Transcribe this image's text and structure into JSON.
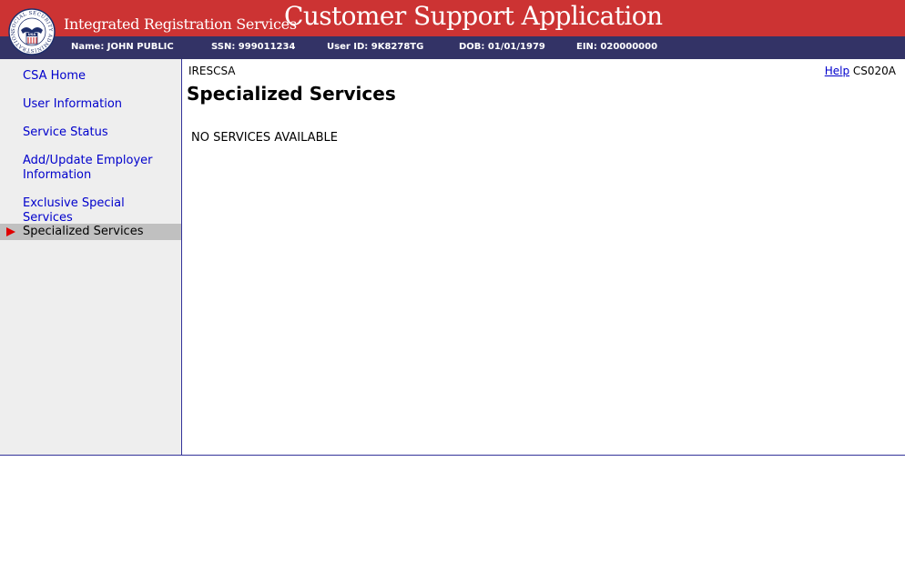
{
  "header": {
    "org_title": "Integrated Registration Services",
    "app_title": "Customer Support Application",
    "seal_text": "SOCIAL SECURITY ADMINISTRATION",
    "seal_center": "USA",
    "brand_color": "#cc3333",
    "bar_color": "#333366"
  },
  "user_bar": {
    "name": "Name: JOHN PUBLIC",
    "ssn": "SSN: 999011234",
    "user_id": "User ID: 9K8278TG",
    "dob": "DOB: 01/01/1979",
    "ein": "EIN: 020000000"
  },
  "sidebar": {
    "items": [
      {
        "label": "CSA Home"
      },
      {
        "label": "User Information"
      },
      {
        "label": "Service Status"
      },
      {
        "label": "Add/Update Employer Information"
      },
      {
        "label": "Exclusive Special Services"
      },
      {
        "label": "Specialized Services",
        "active": true
      }
    ],
    "active_marker_icon": "red-triangle-right-icon"
  },
  "main": {
    "app_code": "IRESCSA",
    "help_label": "Help",
    "screen_id": "CS020A",
    "page_title": "Specialized Services",
    "status_message": "NO SERVICES AVAILABLE"
  }
}
